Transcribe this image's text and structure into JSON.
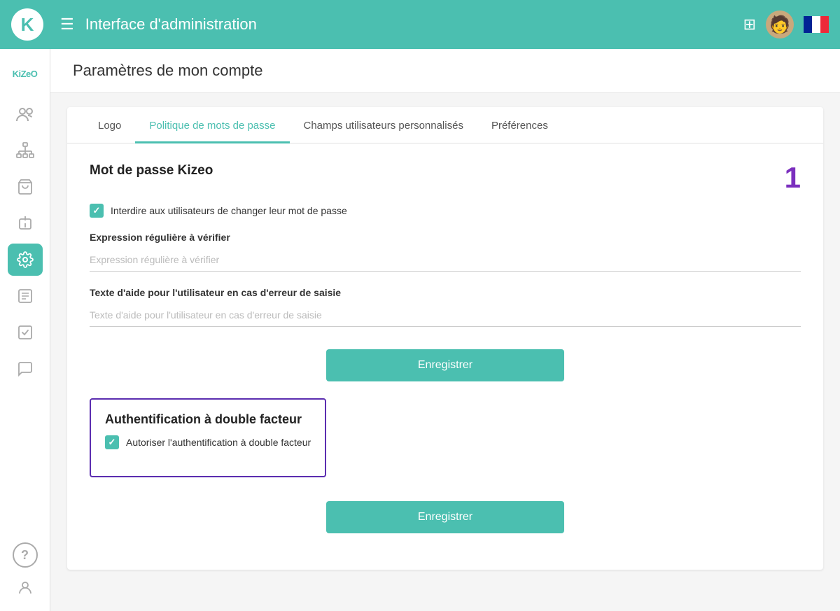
{
  "header": {
    "title": "Interface d'administration",
    "hamburger_label": "☰"
  },
  "sidebar": {
    "brand": "KiZeO",
    "items": [
      {
        "id": "users",
        "icon": "👥",
        "active": false
      },
      {
        "id": "network",
        "icon": "⎇",
        "active": false
      },
      {
        "id": "basket",
        "icon": "🧺",
        "active": false
      },
      {
        "id": "plugin",
        "icon": "🔌",
        "active": false
      },
      {
        "id": "settings",
        "icon": "⚙",
        "active": true
      },
      {
        "id": "forms",
        "icon": "🗒",
        "active": false
      },
      {
        "id": "tasks",
        "icon": "✅",
        "active": false
      },
      {
        "id": "chat",
        "icon": "💬",
        "active": false
      }
    ],
    "bottom_items": [
      {
        "id": "help",
        "icon": "?"
      },
      {
        "id": "profile",
        "icon": "👤"
      }
    ]
  },
  "page": {
    "title": "Paramètres de mon compte"
  },
  "tabs": [
    {
      "id": "logo",
      "label": "Logo",
      "active": false
    },
    {
      "id": "password",
      "label": "Politique de mots de passe",
      "active": true
    },
    {
      "id": "custom-fields",
      "label": "Champs utilisateurs personnalisés",
      "active": false
    },
    {
      "id": "preferences",
      "label": "Préférences",
      "active": false
    }
  ],
  "password_section": {
    "title": "Mot de passe Kizeo",
    "number": "1",
    "checkbox1": {
      "label": "Interdire aux utilisateurs de changer leur mot de passe",
      "checked": true
    },
    "regex_label": "Expression régulière à vérifier",
    "regex_placeholder": "Expression régulière à vérifier",
    "help_label": "Texte d'aide pour l'utilisateur en cas d'erreur de saisie",
    "help_placeholder": "Texte d'aide pour l'utilisateur en cas d'erreur de saisie",
    "save_button": "Enregistrer"
  },
  "tfa_section": {
    "title": "Authentification à double facteur",
    "checkbox": {
      "label": "Autoriser l'authentification à double facteur",
      "checked": true
    },
    "save_button": "Enregistrer"
  }
}
